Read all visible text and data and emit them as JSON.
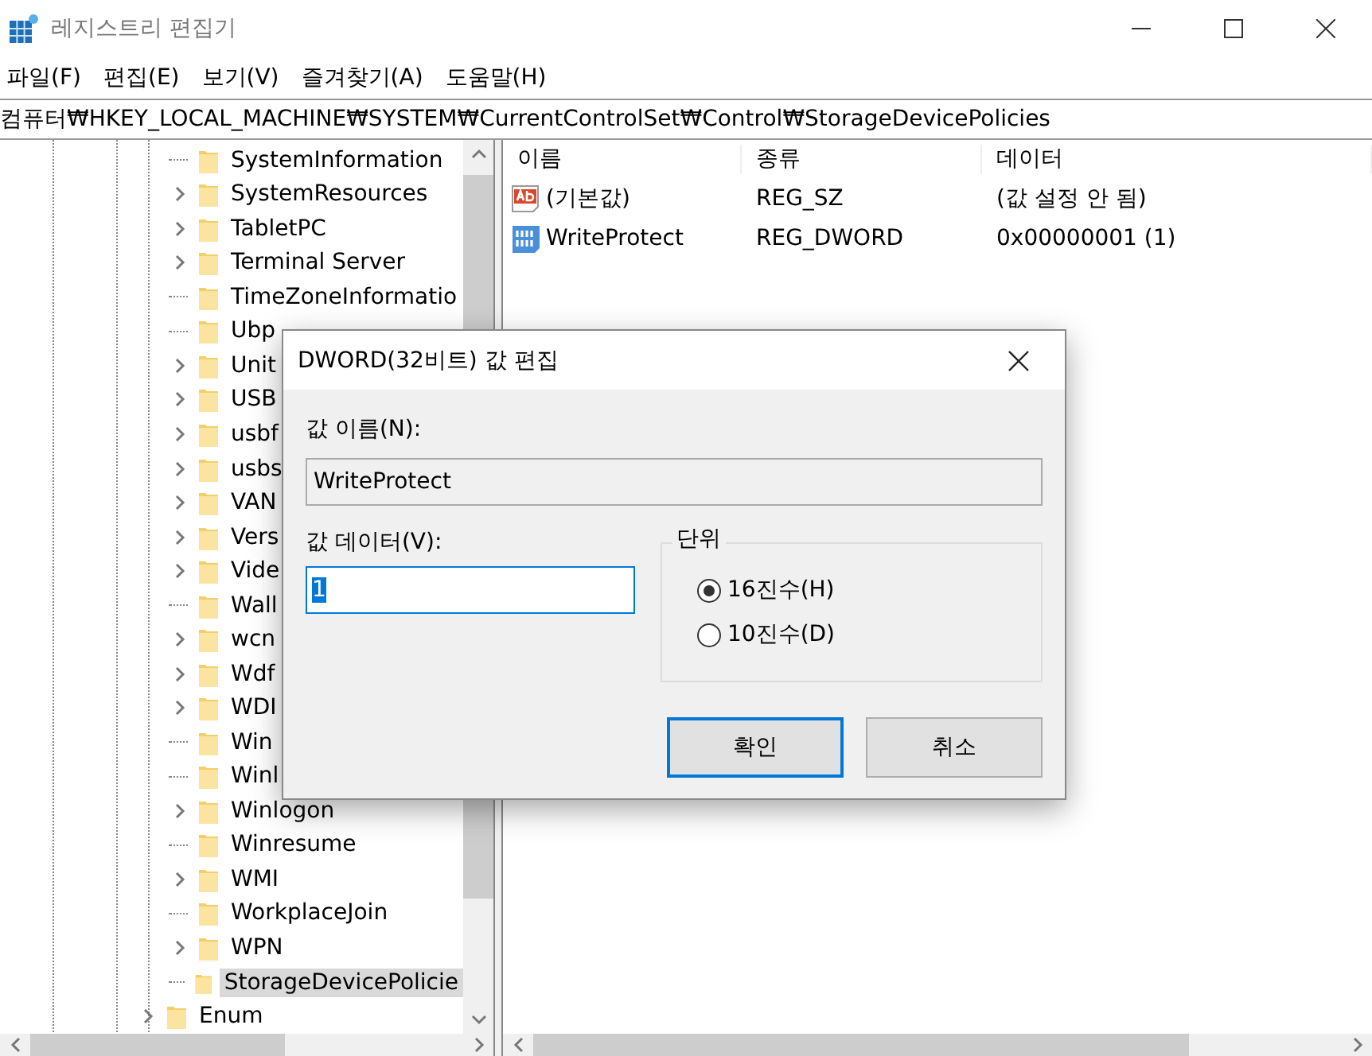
{
  "window": {
    "title": "레지스트리 편집기"
  },
  "menu": [
    "파일(F)",
    "편집(E)",
    "보기(V)",
    "즐겨찾기(A)",
    "도움말(H)"
  ],
  "address": "컴퓨터₩HKEY_LOCAL_MACHINE₩SYSTEM₩CurrentControlSet₩Control₩StorageDevicePolicies",
  "tree": {
    "items": [
      {
        "label": "SystemInformation",
        "kind": "leaf",
        "selected": false
      },
      {
        "label": "SystemResources",
        "kind": "expandable",
        "selected": false
      },
      {
        "label": "TabletPC",
        "kind": "expandable",
        "selected": false
      },
      {
        "label": "Terminal Server",
        "kind": "expandable",
        "selected": false
      },
      {
        "label": "TimeZoneInformatio",
        "kind": "leaf",
        "selected": false
      },
      {
        "label": "Ubp",
        "kind": "leaf",
        "selected": false
      },
      {
        "label": "Unit",
        "kind": "expandable",
        "selected": false
      },
      {
        "label": "USB",
        "kind": "expandable",
        "selected": false
      },
      {
        "label": "usbf",
        "kind": "expandable",
        "selected": false
      },
      {
        "label": "usbs",
        "kind": "expandable",
        "selected": false
      },
      {
        "label": "VAN",
        "kind": "expandable",
        "selected": false
      },
      {
        "label": "Vers",
        "kind": "expandable",
        "selected": false
      },
      {
        "label": "Vide",
        "kind": "expandable",
        "selected": false
      },
      {
        "label": "Wall",
        "kind": "leaf",
        "selected": false
      },
      {
        "label": "wcn",
        "kind": "expandable",
        "selected": false
      },
      {
        "label": "Wdf",
        "kind": "expandable",
        "selected": false
      },
      {
        "label": "WDI",
        "kind": "expandable",
        "selected": false
      },
      {
        "label": "Win",
        "kind": "leaf",
        "selected": false
      },
      {
        "label": "Winl",
        "kind": "leaf",
        "selected": false
      },
      {
        "label": "Winlogon",
        "kind": "expandable",
        "selected": false
      },
      {
        "label": "Winresume",
        "kind": "leaf",
        "selected": false
      },
      {
        "label": "WMI",
        "kind": "expandable",
        "selected": false
      },
      {
        "label": "WorkplaceJoin",
        "kind": "leaf",
        "selected": false
      },
      {
        "label": "WPN",
        "kind": "expandable",
        "selected": false
      },
      {
        "label": "StorageDevicePolicie",
        "kind": "leaf",
        "selected": true
      }
    ],
    "after": [
      {
        "label": "Enum",
        "kind": "expandable",
        "selected": false
      }
    ]
  },
  "values": {
    "columns": [
      "이름",
      "종류",
      "데이터"
    ],
    "rows": [
      {
        "name": "(기본값)",
        "kind": "string",
        "type": "REG_SZ",
        "data": "(값 설정 안 됨)"
      },
      {
        "name": "WriteProtect",
        "kind": "binary",
        "type": "REG_DWORD",
        "data": "0x00000001 (1)"
      }
    ]
  },
  "dialog": {
    "title": "DWORD(32비트) 값 편집",
    "name_label": "값 이름(N):",
    "name_value": "WriteProtect",
    "data_label": "값 데이터(V):",
    "data_value": "1",
    "base_label": "단위",
    "bases": [
      {
        "label": "16진수(H)",
        "selected": true
      },
      {
        "label": "10진수(D)",
        "selected": false
      }
    ],
    "buttons": [
      {
        "label": "확인",
        "default": true
      },
      {
        "label": "취소",
        "default": false
      }
    ]
  }
}
